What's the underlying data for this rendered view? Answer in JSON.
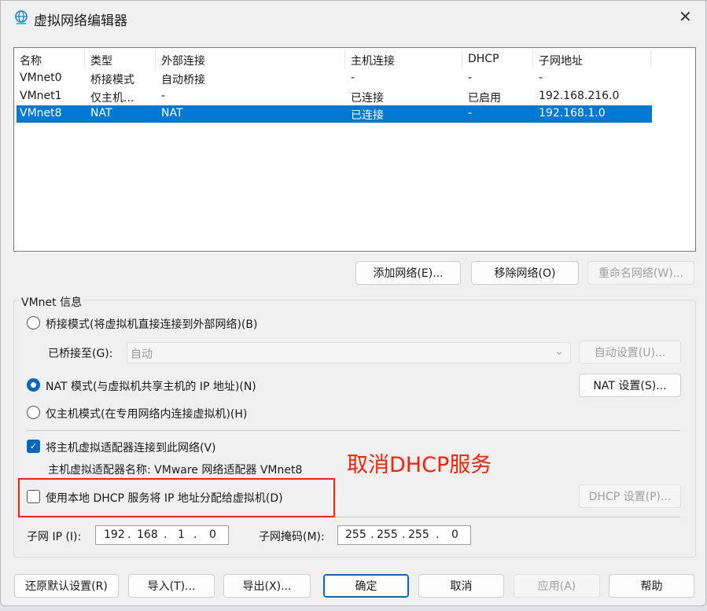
{
  "window": {
    "title": "虚拟网络编辑器",
    "close": "✕"
  },
  "table": {
    "headers": [
      "名称",
      "类型",
      "外部连接",
      "主机连接",
      "DHCP",
      "子网地址"
    ],
    "rows": [
      [
        "VMnet0",
        "桥接模式",
        "自动桥接",
        "-",
        "-",
        "-"
      ],
      [
        "VMnet1",
        "仅主机...",
        "-",
        "已连接",
        "已启用",
        "192.168.216.0"
      ],
      [
        "VMnet8",
        "NAT",
        "NAT",
        "已连接",
        "-",
        "192.168.1.0"
      ]
    ],
    "selected_row": 2
  },
  "list_buttons": {
    "add": "添加网络(E)...",
    "remove": "移除网络(O)",
    "rename": "重命名网络(W)..."
  },
  "info": {
    "group_label": "VMnet 信息",
    "bridge_mode": "桥接模式(将虚拟机直接连接到外部网络)(B)",
    "bridged_to_label": "已桥接至(G):",
    "bridged_to_value": "自动",
    "auto_settings": "自动设置(U)...",
    "nat_mode": "NAT 模式(与虚拟机共享主机的 IP 地址)(N)",
    "nat_settings": "NAT 设置(S)...",
    "host_only": "仅主机模式(在专用网络内连接虚拟机)(H)",
    "connect_adapter": "将主机虚拟适配器连接到此网络(V)",
    "adapter_name": "主机虚拟适配器名称: VMware 网络适配器 VMnet8",
    "use_dhcp": "使用本地 DHCP 服务将 IP 地址分配给虚拟机(D)",
    "dhcp_settings": "DHCP 设置(P)...",
    "subnet_ip_label": "子网 IP (I):",
    "subnet_ip": [
      "192",
      "168",
      "1",
      "0"
    ],
    "mask_label": "子网掩码(M):",
    "mask": [
      "255",
      "255",
      "255",
      "0"
    ],
    "selected_mode": "nat",
    "connect_adapter_checked": true,
    "use_dhcp_checked": false
  },
  "annotation": {
    "text": "取消DHCP服务",
    "color": "#ff2200"
  },
  "footer": {
    "restore": "还原默认设置(R)",
    "import": "导入(T)...",
    "export": "导出(X)...",
    "ok": "确定",
    "cancel": "取消",
    "apply": "应用(A)",
    "help": "帮助"
  }
}
